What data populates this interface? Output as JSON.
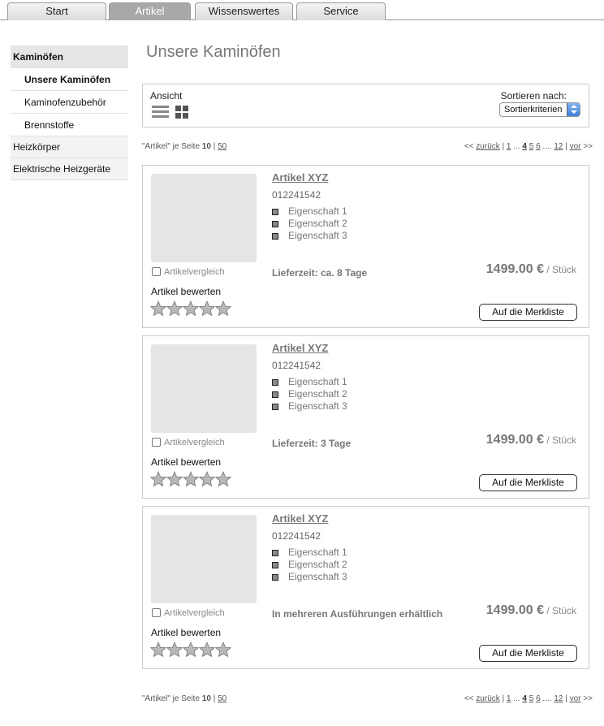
{
  "nav": {
    "tabs": [
      {
        "label": "Start",
        "active": false
      },
      {
        "label": "Artikel",
        "active": true
      },
      {
        "label": "Wissenswertes",
        "active": false
      },
      {
        "label": "Service",
        "active": false
      }
    ]
  },
  "sidebar": {
    "category": "Kaminöfen",
    "subitems": [
      "Unsere Kaminöfen",
      "Kaminofenzubehör",
      "Brennstoffe"
    ],
    "current_subitem": "Unsere Kaminöfen",
    "items": [
      "Heizkörper",
      "Elektrische Heizgeräte"
    ]
  },
  "page_title": "Unsere Kaminöfen",
  "viewbar": {
    "view_label": "Ansicht",
    "list_view_icon": "list-view-icon",
    "grid_view_icon": "grid-view-icon",
    "sort_label": "Sortieren nach:",
    "sort_value": "Sortierkriterien"
  },
  "paging": {
    "perpage_prefix": "\"Artikel\" je Seite",
    "perpage_current": "10",
    "perpage_sep": "|",
    "perpage_alt": "50",
    "prev_prefix": "<<",
    "prev": "zurück",
    "sep": "|",
    "first": "1",
    "ellipsis1": "...",
    "pages": [
      "4",
      "5",
      "6"
    ],
    "current_page": "4",
    "ellipsis2": "....",
    "last": "12",
    "next": "vor",
    "next_suffix": ">>"
  },
  "products": [
    {
      "title": "Artikel XYZ",
      "article_no": "012241542",
      "properties": [
        "Eigenschaft 1",
        "Eigenschaft 2",
        "Eigenschaft 3"
      ],
      "compare_label": "Artikelvergleich",
      "delivery": "Lieferzeit: ca. 8 Tage",
      "price": "1499.00 €",
      "unit": "/ Stück",
      "rate_label": "Artikel bewerten",
      "rating": 0,
      "rating_max": 5,
      "button": "Auf die Merkliste"
    },
    {
      "title": "Artikel XYZ",
      "article_no": "012241542",
      "properties": [
        "Eigenschaft 1",
        "Eigenschaft 2",
        "Eigenschaft 3"
      ],
      "compare_label": "Artikelvergleich",
      "delivery": "Lieferzeit: 3 Tage",
      "price": "1499.00 €",
      "unit": "/ Stück",
      "rate_label": "Artikel bewerten",
      "rating": 0,
      "rating_max": 5,
      "button": "Auf die Merkliste"
    },
    {
      "title": "Artikel XYZ",
      "article_no": "012241542",
      "properties": [
        "Eigenschaft 1",
        "Eigenschaft 2",
        "Eigenschaft 3"
      ],
      "compare_label": "Artikelvergleich",
      "delivery": "In mehreren Ausführungen erhältlich",
      "price": "1499.00 €",
      "unit": "/ Stück",
      "rate_label": "Artikel bewerten",
      "rating": 0,
      "rating_max": 5,
      "button": "Auf die Merkliste"
    }
  ],
  "colors": {
    "active_tab": "#a8a8a8",
    "text_muted": "#777777",
    "border": "#cccccc"
  }
}
